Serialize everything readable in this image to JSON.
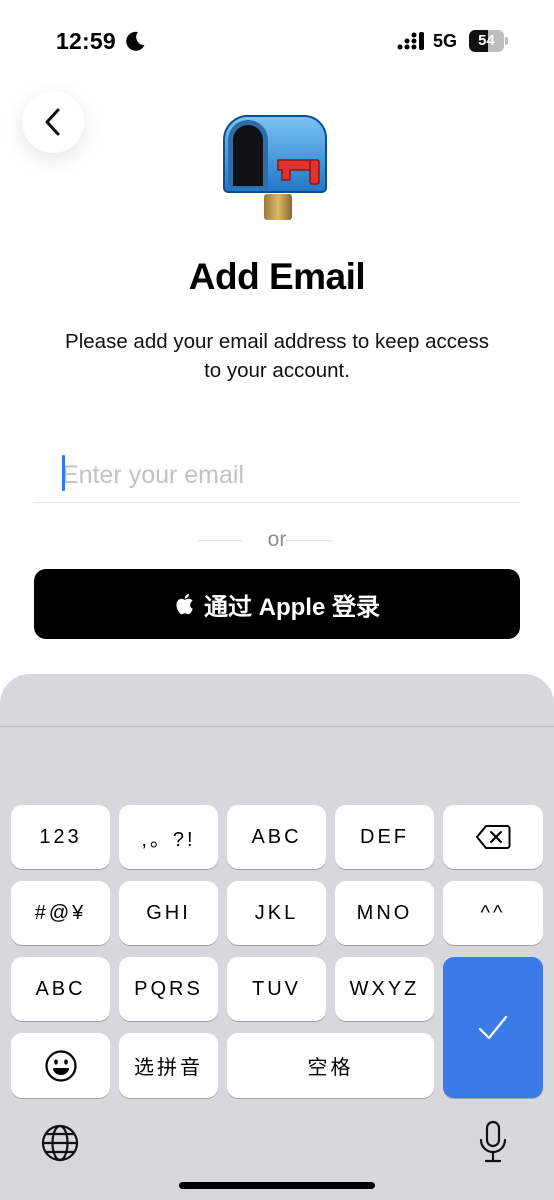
{
  "status_bar": {
    "time": "12:59",
    "network": "5G",
    "battery": "54",
    "battery_level": 0.54
  },
  "header": {
    "title": "Add Email",
    "subtitle": "Please add your email address to keep access to your account."
  },
  "form": {
    "email_placeholder": "Enter your email",
    "email_value": "",
    "divider_text": "or",
    "apple_button_label": "通过 Apple 登录"
  },
  "keyboard": {
    "rows": [
      [
        "123",
        ",。?!",
        "ABC",
        "DEF"
      ],
      [
        "#@¥",
        "GHI",
        "JKL",
        "MNO",
        "^^"
      ],
      [
        "ABC",
        "PQRS",
        "TUV",
        "WXYZ"
      ],
      [
        "选拼音",
        "空格"
      ]
    ]
  },
  "colors": {
    "accent": "#3478f6",
    "keyboard_bg": "#d7d8dc",
    "done_key": "#3a7ae9",
    "apple_button": "#000000"
  }
}
